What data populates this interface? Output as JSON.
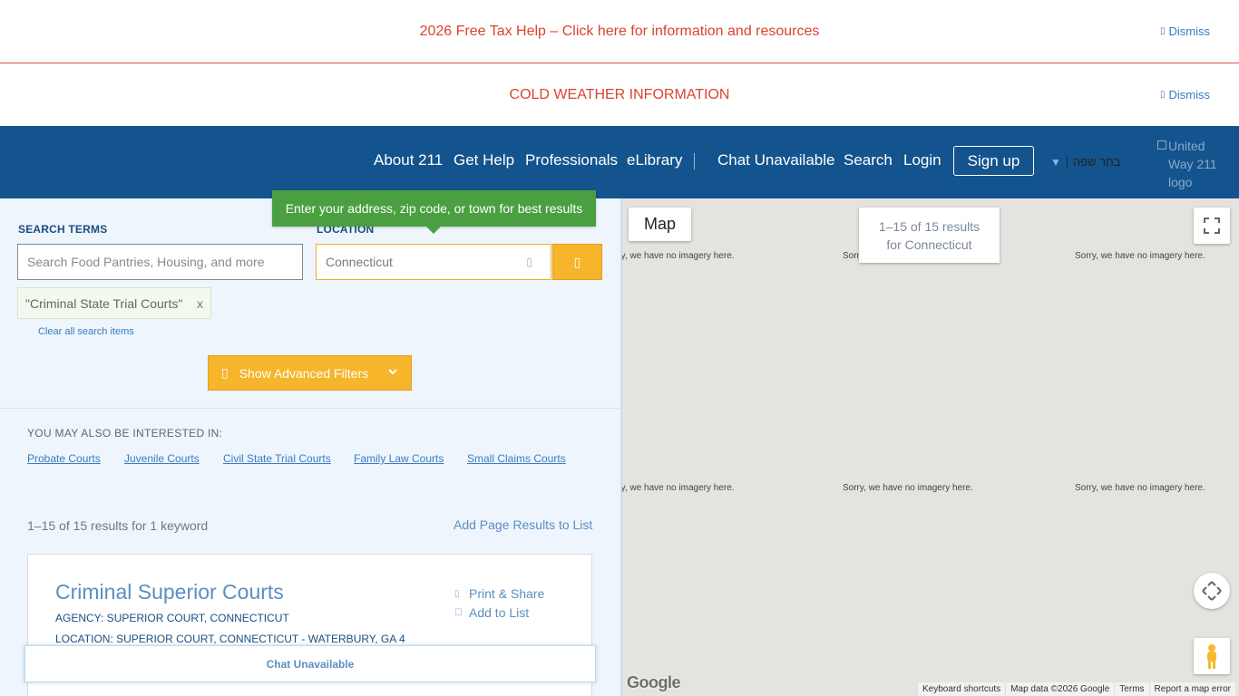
{
  "banners": {
    "tax_help": "2026 Free Tax Help – Click here for information and resources",
    "cold_weather": "COLD WEATHER INFORMATION",
    "dismiss_label": "Dismiss",
    "dismiss_icon": "close-icon",
    "message_color": "#d9442f"
  },
  "nav": {
    "items": [
      "About 211",
      "Get Help",
      "Professionals",
      "eLibrary",
      "Chat Unavailable",
      "Search",
      "Login"
    ],
    "signup": "Sign up",
    "language": "בחר שפה",
    "logo_alt": "United Way 211 logo",
    "background": "#13548e"
  },
  "search": {
    "terms_label": "SEARCH TERMS",
    "terms_placeholder": "Search Food Pantries, Housing, and more",
    "location_label": "LOCATION",
    "location_value": "Connecticut",
    "tooltip": "Enter your address, zip code, or town for best results",
    "chip": "\"Criminal State Trial Courts\"",
    "chip_remove": "x",
    "clear_all": "Clear all search items",
    "advanced_filters": "Show Advanced Filters",
    "accent": "#f6b52b"
  },
  "interested": {
    "heading": "YOU MAY ALSO BE INTERESTED IN:",
    "links": [
      "Probate Courts",
      "Juvenile Courts",
      "Civil State Trial Courts",
      "Family Law Courts",
      "Small Claims Courts"
    ]
  },
  "results": {
    "count": "1–15 of 15 results for 1 keyword",
    "add_page": "Add Page Results to List",
    "first": {
      "title": "Criminal Superior Courts",
      "agency": "AGENCY: SUPERIOR COURT, CONNECTICUT",
      "location": "LOCATION: SUPERIOR COURT, CONNECTICUT - WATERBURY, GA 4",
      "print_share": "Print & Share",
      "add_to_list": "Add to List"
    }
  },
  "chat_bar": "Chat Unavailable",
  "map": {
    "map_button": "Map",
    "results_line1": "1–15 of 15 results",
    "results_line2": "for Connecticut",
    "no_imagery": "Sorry, we have no imagery here.",
    "no_imagery_cut1": "rry, we have no imagery here.",
    "no_imagery_cut2": "Sorr",
    "google": "Google",
    "footer": [
      "Keyboard shortcuts",
      "Map data ©2026 Google",
      "Terms",
      "Report a map error"
    ]
  }
}
